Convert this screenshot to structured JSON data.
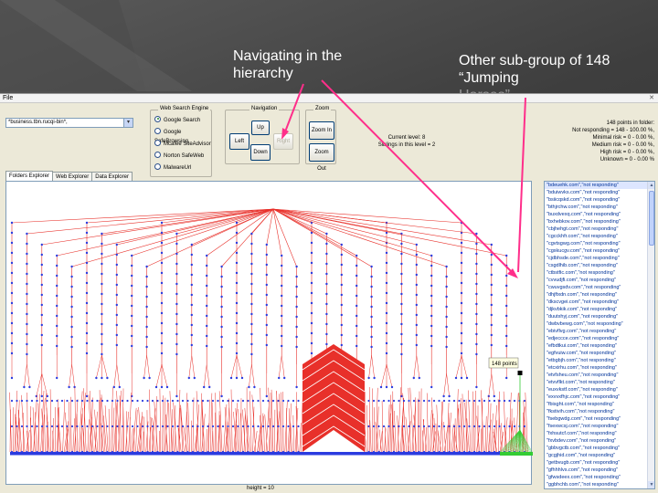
{
  "callouts": {
    "navigating": "Navigating in the hierarchy",
    "subgroup": "Other sub-group of 148 “Jumping",
    "subgroup_faded": "Horses”"
  },
  "menu": {
    "file": "File"
  },
  "search": {
    "value": "*business.tbn.rucqi-bin*,"
  },
  "engine_group": {
    "title": "Web Search Engine",
    "options": [
      "Google Search",
      "Google SafeBrowsing",
      "Mcafee SiteAdvisor",
      "Norton SafeWeb",
      "MalwareUrl"
    ],
    "selected_index": 0
  },
  "navigation": {
    "title": "Navigation",
    "up": "Up",
    "left": "Left",
    "right": "Right",
    "down": "Down"
  },
  "zoom": {
    "title": "Zoom",
    "zoom_in": "Zoom In",
    "zoom_out": "Zoom Out"
  },
  "level_info": {
    "current_level": "Current level: 8",
    "siblings": "Siblings in this level = 2"
  },
  "stats": {
    "points": "148 points in folder:",
    "not_responding": "Not responding = 148 - 100.00 %,",
    "minimal": "Minimal risk = 0 - 0.00 %,",
    "medium": "Medium risk = 0 - 0.00 %,",
    "high": "High risk = 0 - 0.00 %,",
    "unknown": "Unknown = 0 - 0.00 %"
  },
  "tabs": [
    "Folders Explorer",
    "Web Explorer",
    "Data Explorer"
  ],
  "tree": {
    "node_label": "148 points"
  },
  "status": {
    "height": "height = 10"
  },
  "list": {
    "items": [
      "\"bdeuehk.com\",\"not responding\"",
      "\"bduiwvks.com\",\"not responding\"",
      "\"bsiicqskd.com\",\"not responding\"",
      "\"bthjrchw.com\",\"not responding\"",
      "\"buxdvexq.com\",\"not responding\"",
      "\"bxhebkov.com\",\"not responding\"",
      "\"cbjhehgt.com\",\"not responding\"",
      "\"cgcckhfr.com\",\"not responding\"",
      "\"cgvtsgwg.com\",\"not responding\"",
      "\"cgxkucgv.com\",\"not responding\"",
      "\"cjdbhsde.com\",\"not responding\"",
      "\"csgdlhib.com\",\"not responding\"",
      "\"ctbstfic.com\",\"not responding\"",
      "\"cvvudjfi.com\",\"not responding\"",
      "\"cwuvgsdv.com\",\"not responding\"",
      "\"dhjftxdn.com\",\"not responding\"",
      "\"dkscvgei.com\",\"not responding\"",
      "\"djkvbkik.com\",\"not responding\"",
      "\"duutxhyj.com\",\"not responding\"",
      "\"dwbvbewg.com\",\"not responding\"",
      "\"ebivflvg.com\",\"not responding\"",
      "\"edjeccce.com\",\"not responding\"",
      "\"efbdtkui.com\",\"not responding\"",
      "\"egfvuiw.com\",\"not responding\"",
      "\"etbgbjh.com\",\"not responding\"",
      "\"etcxirhu.com\",\"not responding\"",
      "\"etvfsheu.com\",\"not responding\"",
      "\"etvvflkt.com\",\"not responding\"",
      "\"euxvkstf.com\",\"not responding\"",
      "\"exvvxfhjc.com\",\"not responding\"",
      "\"fbisght.com\",\"not responding\"",
      "\"fkstivih.com\",\"not responding\"",
      "\"fsebgwdg.com\",\"not responding\"",
      "\"fsexwcsj.com\",\"not responding\"",
      "\"fxhsutcf.com\",\"not responding\"",
      "\"fxvbdev.com\",\"not responding\"",
      "\"gbbvgctb.com\",\"not responding\"",
      "\"gcgjhid.com\",\"not responding\"",
      "\"getbvugb.com\",\"not responding\"",
      "\"gfhhhlvs.com\",\"not responding\"",
      "\"gfwsdeex.com\",\"not responding\"",
      "\"ggbhchb.com\",\"not responding\"",
      "\"ggelsuvi.com\",\"not responding\""
    ],
    "selected_index": 0
  },
  "colors": {
    "tree_edge": "#e8302a",
    "tree_node": "#2a3be0",
    "highlight": "#33cc33",
    "callout_arrow": "#ff2e8a"
  }
}
